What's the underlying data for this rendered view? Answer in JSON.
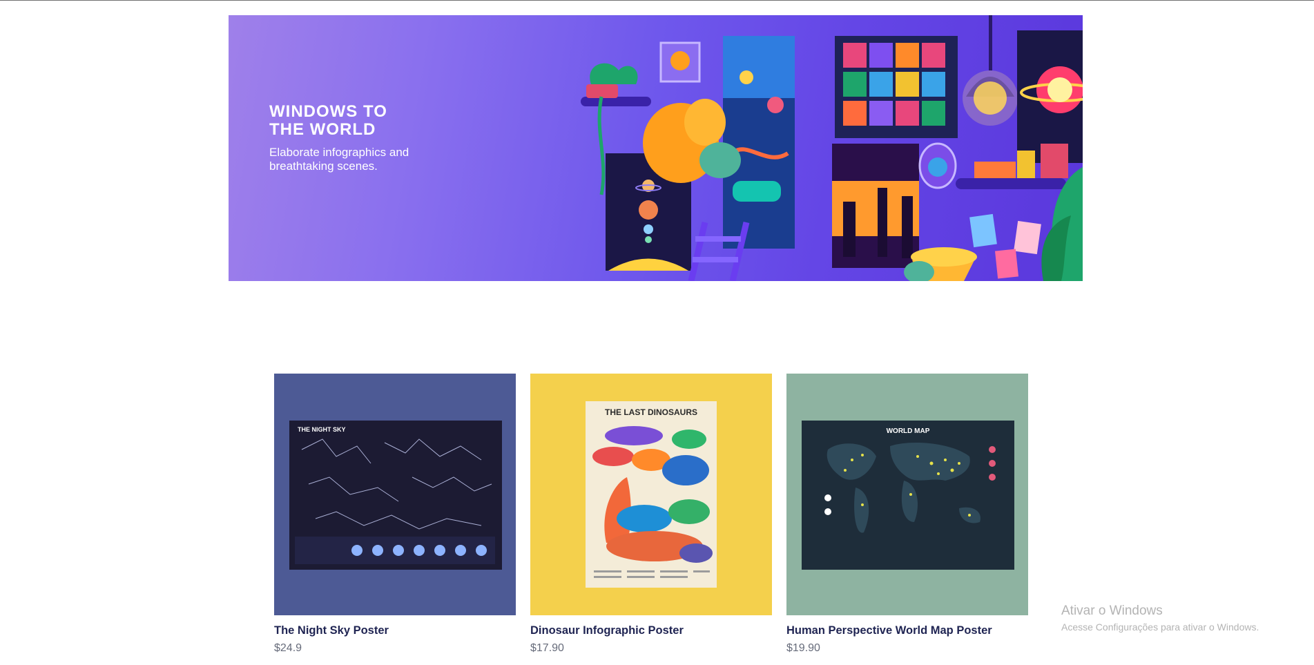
{
  "hero": {
    "title": "WINDOWS TO\nTHE WORLD",
    "subtitle": "Elaborate infographics and breathtaking scenes."
  },
  "products": [
    {
      "name": "The Night Sky Poster",
      "price": "$24.9",
      "poster_title": "THE NIGHT SKY",
      "background": "#4d5a95"
    },
    {
      "name": "Dinosaur Infographic Poster",
      "price": "$17.90",
      "poster_title": "THE LAST DINOSAURS",
      "background": "#f4d04c"
    },
    {
      "name": "Human Perspective World Map Poster",
      "price": "$19.90",
      "poster_title": "WORLD MAP",
      "background": "#8eb3a1"
    }
  ],
  "watermark": {
    "title": "Ativar o Windows",
    "subtitle": "Acesse Configurações para ativar o Windows."
  }
}
